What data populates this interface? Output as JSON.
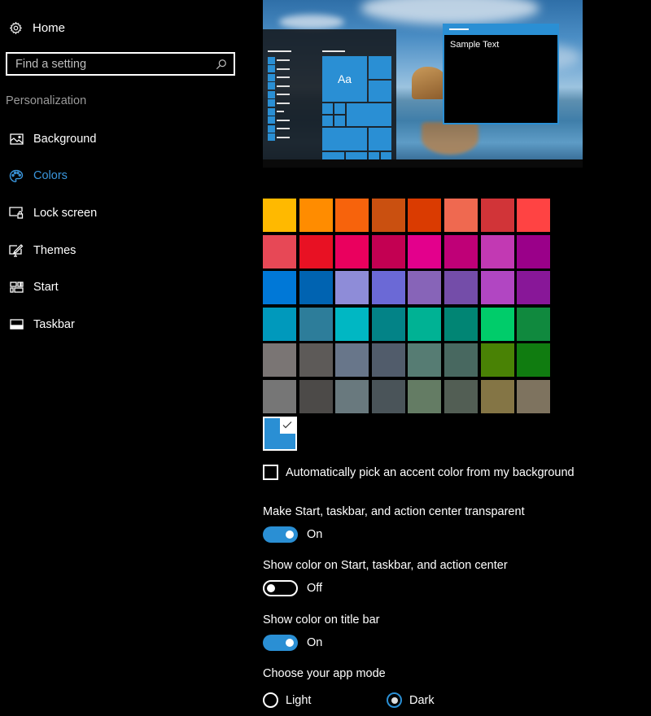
{
  "sidebar": {
    "home_label": "Home",
    "search_placeholder": "Find a setting",
    "section_title": "Personalization",
    "items": [
      {
        "label": "Background",
        "icon": "picture-icon",
        "active": false
      },
      {
        "label": "Colors",
        "icon": "palette-icon",
        "active": true
      },
      {
        "label": "Lock screen",
        "icon": "lock-screen-icon",
        "active": false
      },
      {
        "label": "Themes",
        "icon": "themes-icon",
        "active": false
      },
      {
        "label": "Start",
        "icon": "start-tiles-icon",
        "active": false
      },
      {
        "label": "Taskbar",
        "icon": "taskbar-icon",
        "active": false
      }
    ]
  },
  "preview": {
    "tile_text": "Aa",
    "sample_text": "Sample Text"
  },
  "colors": {
    "accent": "#2a8fd4",
    "active_nav": "#3a96dd",
    "swatches": [
      "#FFB900",
      "#FF8C00",
      "#F7630C",
      "#CA5010",
      "#DA3B01",
      "#EF6950",
      "#D13438",
      "#FF4343",
      "#E74856",
      "#E81123",
      "#EA005E",
      "#C30052",
      "#E3008C",
      "#BF0077",
      "#C239B3",
      "#9A0089",
      "#0078D7",
      "#0063B1",
      "#8E8CD8",
      "#6B69D6",
      "#8764B8",
      "#744DA9",
      "#B146C2",
      "#881798",
      "#0099BC",
      "#2D7D9A",
      "#00B7C3",
      "#038387",
      "#00B294",
      "#018574",
      "#00CC6A",
      "#10893E",
      "#7A7574",
      "#5D5A58",
      "#68768A",
      "#515C6B",
      "#567C73",
      "#486860",
      "#498205",
      "#107C10",
      "#767676",
      "#4C4A48",
      "#69797E",
      "#4A5459",
      "#647C64",
      "#525E54",
      "#847545",
      "#7E735F"
    ],
    "selected_custom": "#2a8fd4"
  },
  "auto_pick": {
    "label": "Automatically pick an accent color from my background",
    "checked": false
  },
  "settings": {
    "transparent": {
      "label": "Make Start, taskbar, and action center transparent",
      "state": "On"
    },
    "show_color_start": {
      "label": "Show color on Start, taskbar, and action center",
      "state": "Off"
    },
    "show_color_title": {
      "label": "Show color on title bar",
      "state": "On"
    }
  },
  "app_mode": {
    "label": "Choose your app mode",
    "options": [
      "Light",
      "Dark"
    ],
    "selected": "Dark"
  }
}
